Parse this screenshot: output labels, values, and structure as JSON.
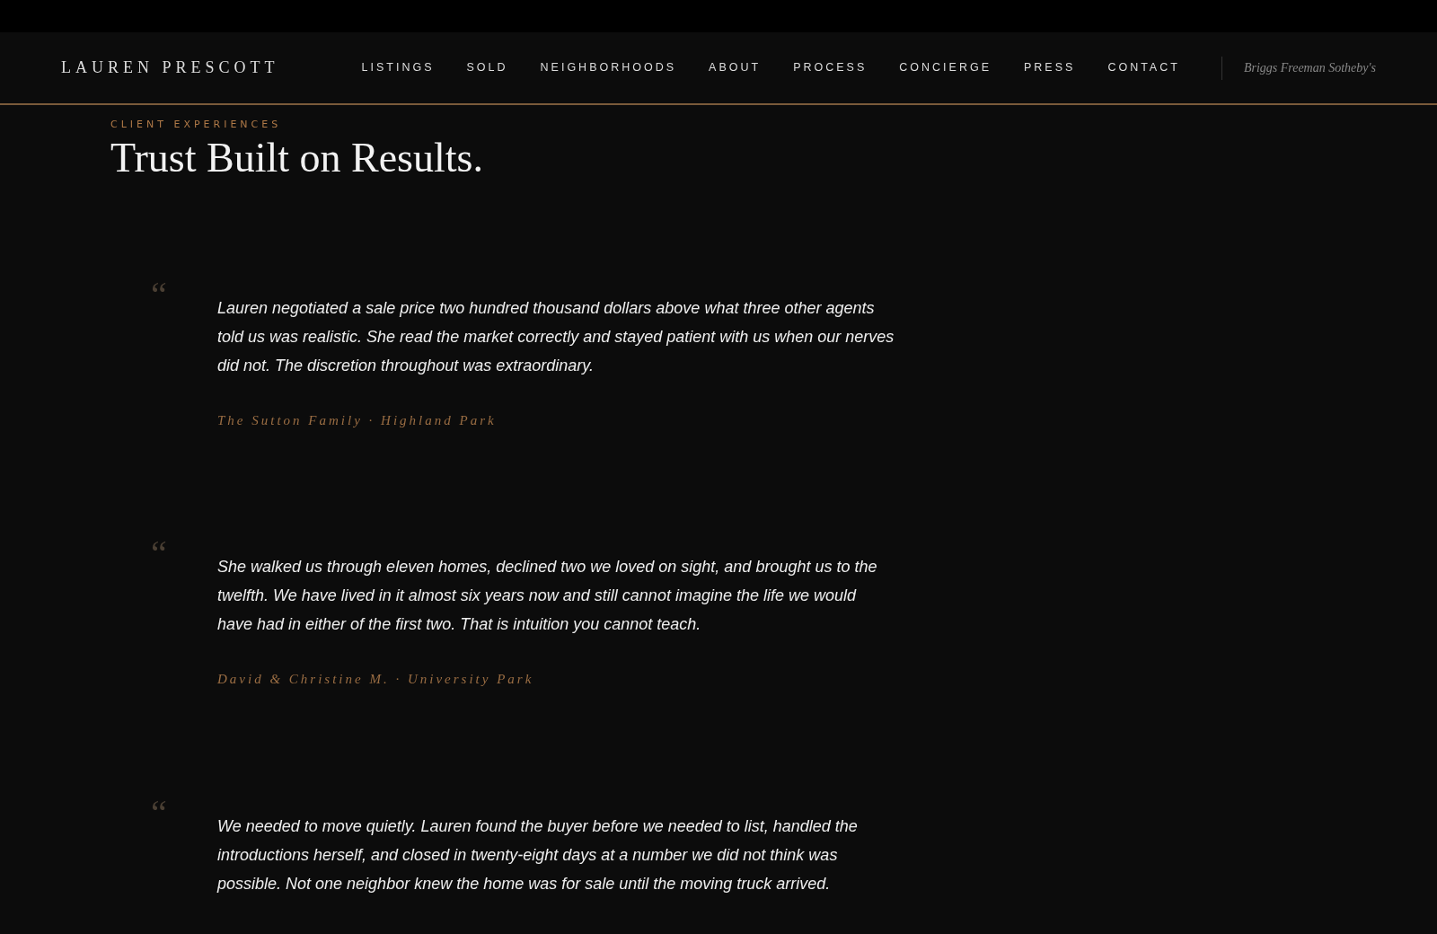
{
  "brand": "LAUREN PRESCOTT",
  "nav": [
    {
      "label": "LISTINGS"
    },
    {
      "label": "SOLD"
    },
    {
      "label": "NEIGHBORHOODS"
    },
    {
      "label": "ABOUT"
    },
    {
      "label": "PROCESS"
    },
    {
      "label": "CONCIERGE"
    },
    {
      "label": "PRESS"
    },
    {
      "label": "CONTACT"
    }
  ],
  "brokerage": "Briggs Freeman Sotheby's",
  "section": {
    "eyebrow": "CLIENT EXPERIENCES",
    "heading": "Trust Built on Results."
  },
  "testimonials": [
    {
      "mark": "“",
      "quote": "Lauren negotiated a sale price two hundred thousand dollars above what three other agents told us was realistic. She read the market correctly and stayed patient with us when our nerves did not. The discretion throughout was extraordinary.",
      "attribution": "The Sutton Family · Highland Park"
    },
    {
      "mark": "“",
      "quote": "She walked us through eleven homes, declined two we loved on sight, and brought us to the twelfth. We have lived in it almost six years now and still cannot imagine the life we would have had in either of the first two. That is intuition you cannot teach.",
      "attribution": "David & Christine M. · University Park"
    },
    {
      "mark": "“",
      "quote": "We needed to move quietly. Lauren found the buyer before we needed to list, handled the introductions herself, and closed in twenty-eight days at a number we did not think was possible. Not one neighbor knew the home was for sale until the moving truck arrived."
    }
  ]
}
